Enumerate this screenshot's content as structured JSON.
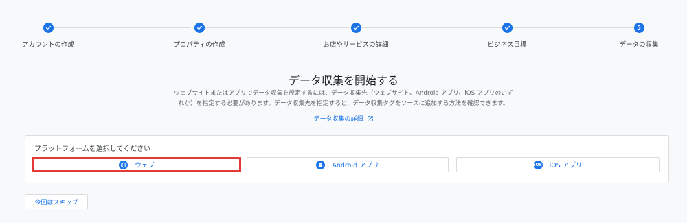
{
  "stepper": {
    "steps": [
      {
        "label": "アカウントの作成",
        "status": "done",
        "marker": ""
      },
      {
        "label": "プロパティの作成",
        "status": "done",
        "marker": ""
      },
      {
        "label": "お店やサービスの詳細",
        "status": "done",
        "marker": ""
      },
      {
        "label": "ビジネス目標",
        "status": "done",
        "marker": ""
      },
      {
        "label": "データの収集",
        "status": "current",
        "marker": "5"
      }
    ]
  },
  "main": {
    "title": "データ収集を開始する",
    "description": "ウェブサイトまたはアプリでデータ収集を設定するには、データ収集先（ウェブサイト、Android アプリ、iOS アプリのいずれか）を指定する必要があります。データ収集先を指定すると、データ収集タグをソースに追加する方法を確認できます。",
    "learn_more": "データ収集の詳細"
  },
  "platform": {
    "title": "プラットフォームを選択してください",
    "options": [
      {
        "label": "ウェブ",
        "icon": "globe-icon",
        "selected": true
      },
      {
        "label": "Android アプリ",
        "icon": "android-icon",
        "selected": false
      },
      {
        "label": "iOS アプリ",
        "icon": "ios-icon",
        "icon_text": "iOS",
        "selected": false
      }
    ]
  },
  "footer": {
    "skip_label": "今回はスキップ"
  },
  "colors": {
    "accent": "#1a73e8",
    "highlight": "#e53935",
    "background": "#f8f9fa"
  }
}
